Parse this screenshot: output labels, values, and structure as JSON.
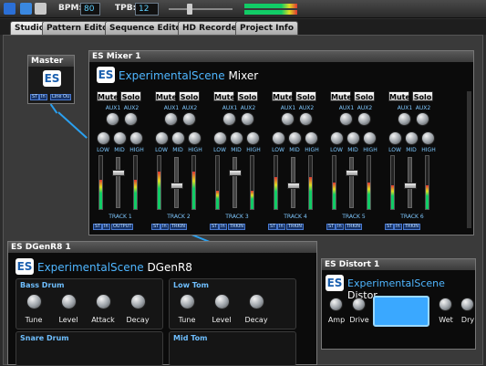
{
  "toolbar": {
    "bpm_label": "BPM:",
    "bpm_value": "80",
    "tpb_label": "TPB:",
    "tpb_value": "12"
  },
  "tabs": [
    {
      "label": "Studio",
      "active": true
    },
    {
      "label": "Pattern Editor",
      "active": false
    },
    {
      "label": "Sequence Editor",
      "active": false
    },
    {
      "label": "HD Recorder",
      "active": false
    },
    {
      "label": "Project Info",
      "active": false
    }
  ],
  "master": {
    "title": "Master",
    "logo": "ES",
    "ports": [
      "ST",
      "In",
      "Line Ou"
    ]
  },
  "mixer": {
    "title": "ES Mixer 1",
    "brand_main": "ExperimentalScene",
    "brand_suffix": "Mixer",
    "logo": "ES",
    "mute_label": "Mute",
    "solo_label": "Solo",
    "aux1_label": "AUX1",
    "aux2_label": "AUX2",
    "low_label": "LOW",
    "mid_label": "MID",
    "high_label": "HIGH",
    "tracks": [
      "TRACK 1",
      "TRACK 2",
      "TRACK 3",
      "TRACK 4",
      "TRACK 5",
      "TRACK 6"
    ],
    "port_st": "ST",
    "port_in": "In",
    "port_out": "OUTPUT",
    "port_trk": "TRKIN"
  },
  "dgenr8": {
    "title": "ES DGenR8 1",
    "brand_main": "ExperimentalScene",
    "brand_suffix": "DGenR8",
    "logo": "ES",
    "groups": [
      {
        "title": "Bass Drum",
        "knobs": [
          "Tune",
          "Level",
          "Attack",
          "Decay"
        ]
      },
      {
        "title": "Low Tom",
        "knobs": [
          "Tune",
          "Level",
          "Decay"
        ]
      },
      {
        "title": "Snare Drum",
        "knobs": []
      },
      {
        "title": "Mid Tom",
        "knobs": []
      }
    ]
  },
  "distort": {
    "title": "ES Distort 1",
    "brand_main": "ExperimentalScene",
    "brand_suffix": "Distor",
    "logo": "ES",
    "knobs": [
      "Amp",
      "Drive",
      "Wet",
      "Dry"
    ]
  },
  "colors": {
    "accent": "#2aa0f0",
    "panel": "#0b0b0b",
    "brand_blue": "#4fb6ff"
  }
}
